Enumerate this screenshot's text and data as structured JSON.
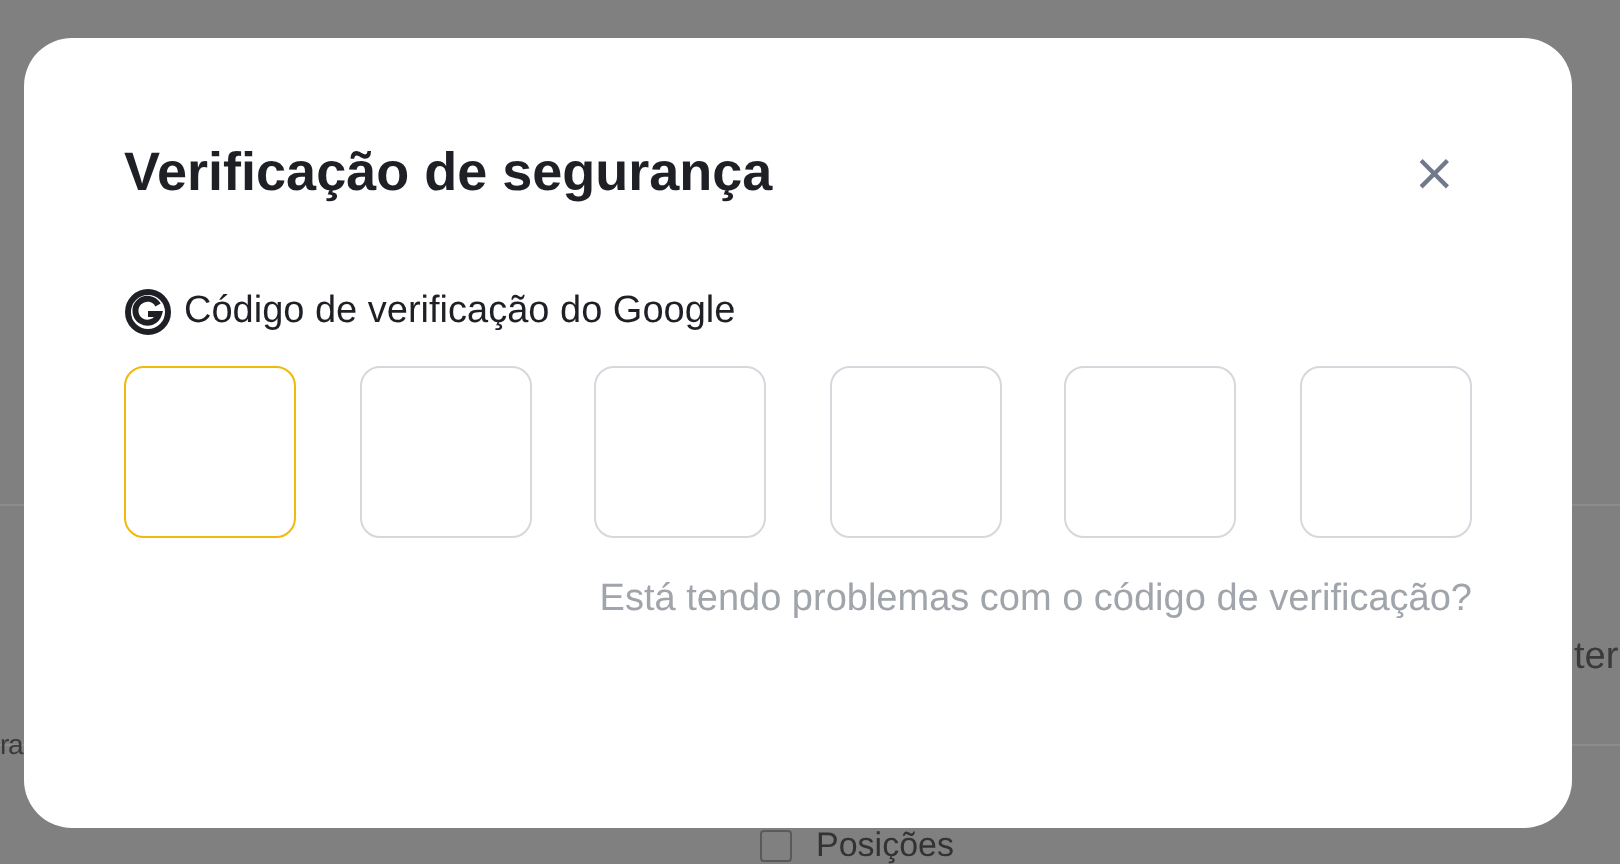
{
  "background": {
    "texts": [
      "ter",
      "ra"
    ],
    "checkbox": {
      "label": "Posições",
      "checked": false
    }
  },
  "dialog": {
    "title": "Verificação de segurança",
    "close": "×",
    "field_label": "Código de verificação do Google",
    "code_boxes": [
      {
        "selected": true
      },
      {
        "selected": false
      },
      {
        "selected": false
      },
      {
        "selected": false
      },
      {
        "selected": false
      },
      {
        "selected": false
      }
    ],
    "help_link": "Está tendo problemas com o código de verificação?"
  }
}
